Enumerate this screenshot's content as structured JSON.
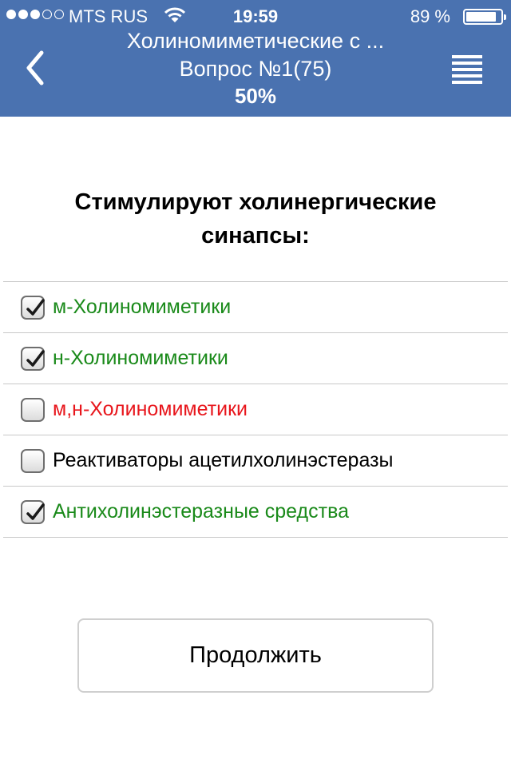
{
  "status_bar": {
    "carrier": "MTS RUS",
    "time": "19:59",
    "battery_percent": "89 %",
    "battery_level": 0.89,
    "signal_bars_filled": 3,
    "signal_bars_total": 5
  },
  "header": {
    "title": "Холиномиметические с ...",
    "question_number": "Вопрос №1(75)",
    "progress": "50%",
    "background_color": "#4a72b0",
    "back_icon": "chevron-left-icon",
    "menu_icon": "hamburger-menu-icon"
  },
  "question": {
    "text": "Стимулируют холинергические синапсы:"
  },
  "options": [
    {
      "label": "м-Холиномиметики",
      "checked": true,
      "color": "#1a8a1a"
    },
    {
      "label": "н-Холиномиметики",
      "checked": true,
      "color": "#1a8a1a"
    },
    {
      "label": "м,н-Холиномиметики",
      "checked": false,
      "color": "#e8161c"
    },
    {
      "label": "Реактиваторы ацетилхолинэстеразы",
      "checked": false,
      "color": "#000000"
    },
    {
      "label": "Антихолинэстеразные средства",
      "checked": true,
      "color": "#1a8a1a"
    }
  ],
  "continue_button": {
    "label": "Продолжить"
  }
}
